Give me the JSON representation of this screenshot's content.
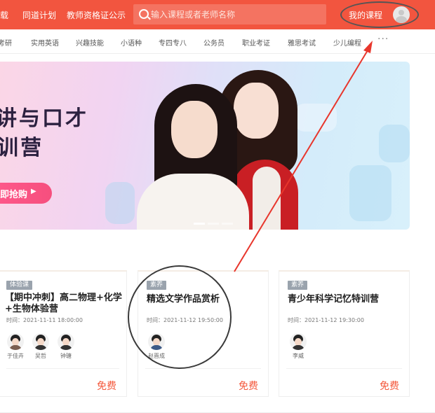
{
  "topbar": {
    "nav": [
      "下载",
      "同道计划",
      "教师资格证公示"
    ],
    "search_placeholder": "输入课程或者老师名称",
    "my_courses": "我的课程"
  },
  "categories": [
    "考研",
    "实用英语",
    "兴趣技能",
    "小语种",
    "专四专八",
    "公务员",
    "职业考证",
    "雅思考试",
    "少儿编程"
  ],
  "more_label": "···",
  "banner": {
    "title_line1": "讲与口才",
    "title_line2": "训营",
    "button_label": "即抢购",
    "button_arrow": "▶"
  },
  "cards": [
    {
      "tag": "体验课",
      "title": "【期中冲刺】高二物理+化学+生物体验营",
      "time": "时间：2021-11-11 18:00:00",
      "teachers": [
        "于佳卉",
        "吴哲",
        "钟瑭"
      ],
      "price": "免费"
    },
    {
      "tag": "素养",
      "title": "精选文学作品赏析",
      "time": "时间：2021-11-12 19:50:00",
      "teachers": [
        "赵晋成"
      ],
      "price": "免费"
    },
    {
      "tag": "素养",
      "title": "青少年科学记忆特训营",
      "time": "时间：2021-11-12 19:30:00",
      "teachers": [
        "李威"
      ],
      "price": "免费"
    }
  ],
  "colors": {
    "topbar": "#f2553f",
    "price": "#f4583c",
    "tag": "#9aa3ad",
    "annotation_arrow": "#e8362c"
  }
}
